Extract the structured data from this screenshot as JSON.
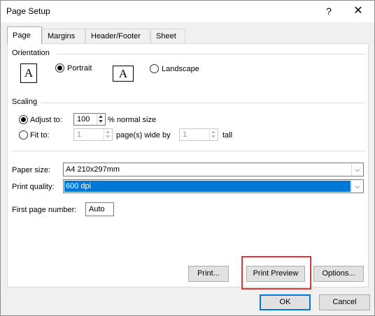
{
  "window": {
    "title": "Page Setup",
    "help_glyph": "?",
    "close_glyph": "✕"
  },
  "tabs": [
    {
      "label": "Page",
      "active": true
    },
    {
      "label": "Margins",
      "active": false
    },
    {
      "label": "Header/Footer",
      "active": false
    },
    {
      "label": "Sheet",
      "active": false
    }
  ],
  "orientation": {
    "label": "Orientation",
    "portrait_label": "Portrait",
    "landscape_label": "Landscape",
    "icon_glyph": "A",
    "selected": "portrait"
  },
  "scaling": {
    "label": "Scaling",
    "adjust_to_label": "Adjust to:",
    "adjust_to_value": "100",
    "adjust_to_suffix": "% normal size",
    "fit_to_label": "Fit to:",
    "fit_wide_value": "1",
    "fit_wide_suffix": "page(s) wide by",
    "fit_tall_value": "1",
    "fit_tall_suffix": "tall",
    "selected": "adjust_to"
  },
  "paper_size": {
    "label": "Paper size:",
    "value": "A4 210x297mm"
  },
  "print_quality": {
    "label": "Print quality:",
    "value": "600 dpi"
  },
  "first_page_number": {
    "label": "First page number:",
    "value": "Auto"
  },
  "buttons": {
    "print": "Print...",
    "print_preview": "Print Preview",
    "options": "Options...",
    "ok": "OK",
    "cancel": "Cancel"
  },
  "colors": {
    "accent": "#0078d7",
    "highlight_box": "#e0363b"
  }
}
